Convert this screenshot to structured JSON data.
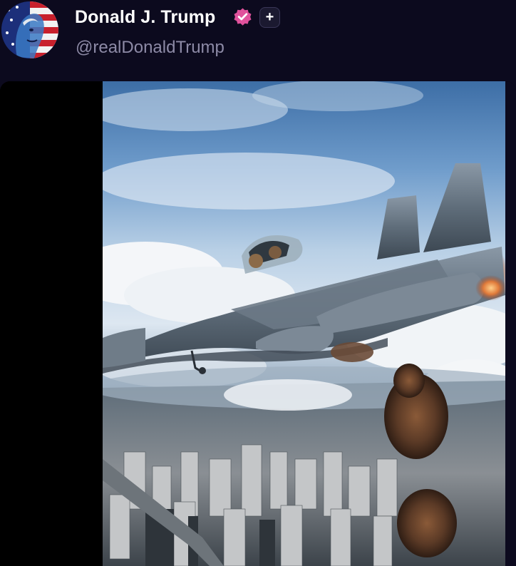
{
  "post": {
    "author": {
      "display_name": "Donald J. Trump",
      "handle": "@realDonaldTrump",
      "verified": true,
      "avatar_icon": "flag-portrait-avatar",
      "badge_color": "#e0529c"
    },
    "follow_button": {
      "icon": "plus-icon"
    },
    "media": {
      "type": "video",
      "scene_icon": "fighter-jet-over-city-frame"
    }
  },
  "colors": {
    "background": "#0c0a1e",
    "name_text": "#ffffff",
    "handle_text": "#8d8aa6",
    "media_letterbox": "#000000"
  }
}
